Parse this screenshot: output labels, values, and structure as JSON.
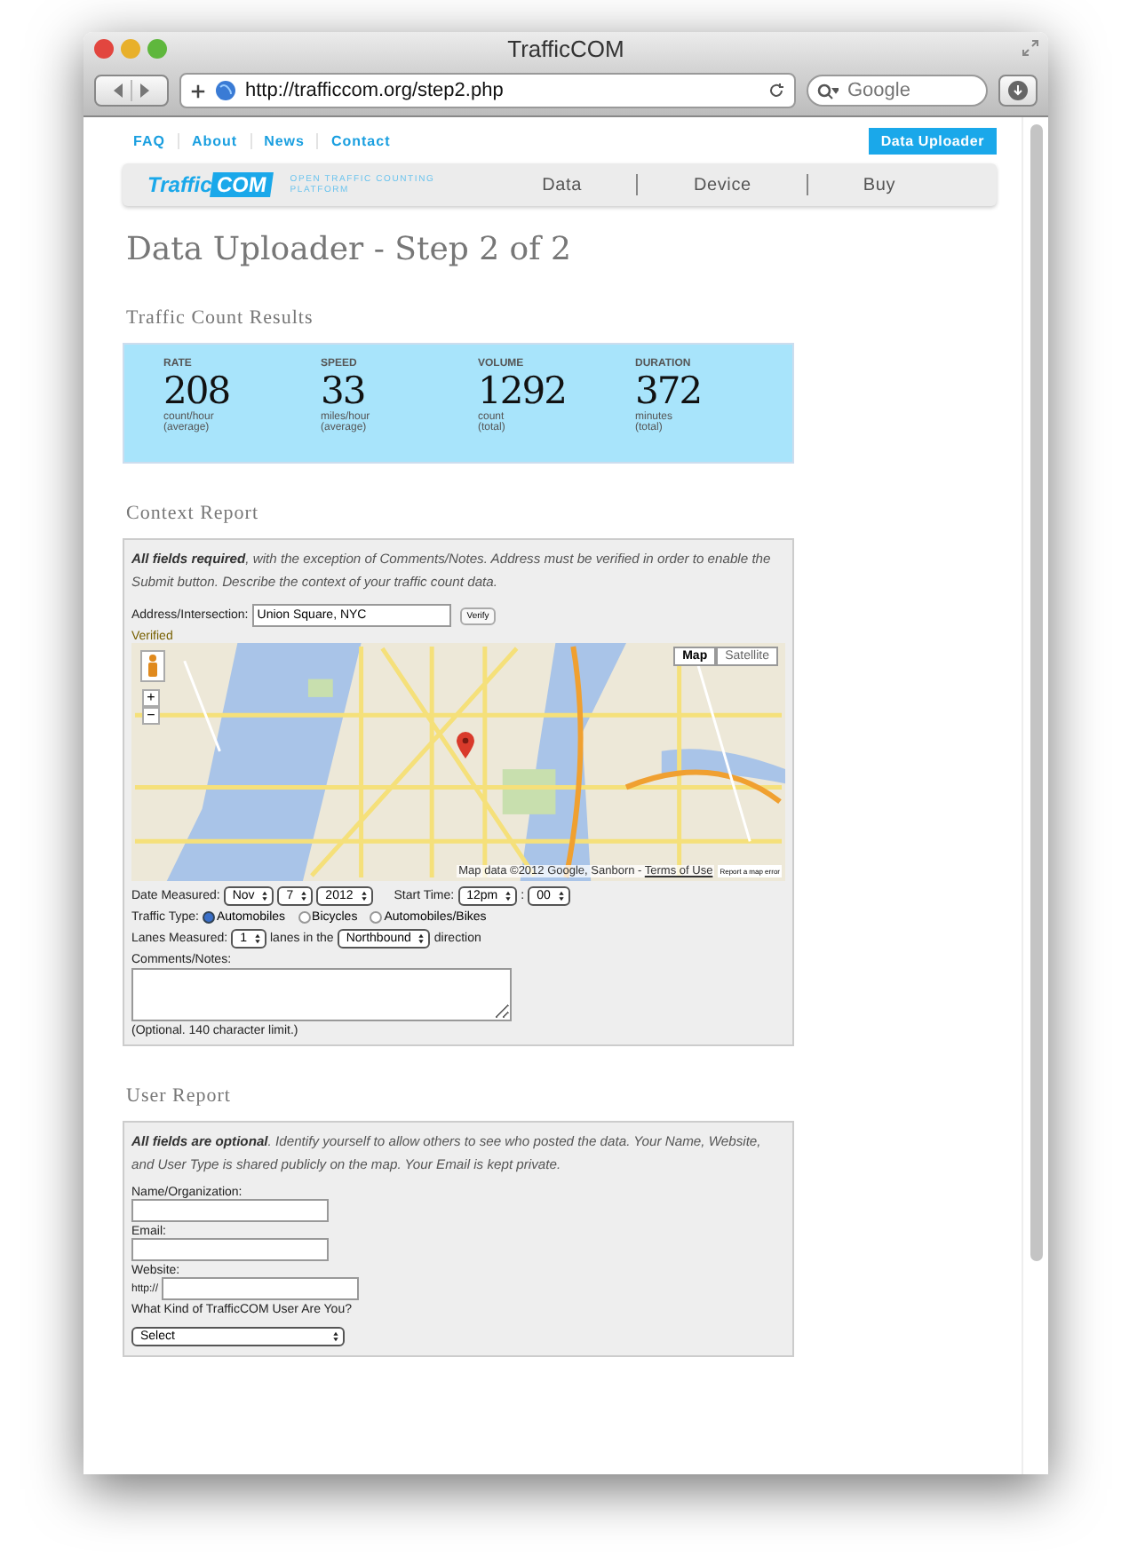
{
  "window": {
    "title": "TrafficCOM"
  },
  "toolbar": {
    "url": "http://trafficcom.org/step2.php",
    "search": {
      "placeholder": "Google"
    }
  },
  "top_links": [
    {
      "label": "FAQ"
    },
    {
      "label": "About"
    },
    {
      "label": "News"
    },
    {
      "label": "Contact"
    }
  ],
  "uploader_button": "Data Uploader",
  "logo": {
    "text": "Traffic",
    "highlight": "COM",
    "tagline": "OPEN TRAFFIC COUNTING PLATFORM"
  },
  "nav": [
    "Data",
    "Device",
    "Buy"
  ],
  "page_title": "Data Uploader - Step 2 of 2",
  "results": {
    "heading": "Traffic Count Results",
    "stats": [
      {
        "label": "RATE",
        "value": "208",
        "unit": "count/hour",
        "note": "(average)"
      },
      {
        "label": "SPEED",
        "value": "33",
        "unit": "miles/hour",
        "note": "(average)"
      },
      {
        "label": "VOLUME",
        "value": "1292",
        "unit": "count",
        "note": "(total)"
      },
      {
        "label": "DURATION",
        "value": "372",
        "unit": "minutes",
        "note": "(total)"
      }
    ]
  },
  "context": {
    "heading": "Context Report",
    "intro": "**All fields required**, with the exception of Comments/Notes. Address must be verified in order to enable the Submit button. Describe the context of your traffic count data.",
    "address": {
      "label": "Address/Intersection:",
      "value": "Union Square, NYC",
      "button": "Verify",
      "status": "Verified"
    },
    "map": {
      "kind": "picture",
      "types": [
        {
          "label": "Map",
          "selected": true
        },
        {
          "label": "Satellite",
          "selected": false
        }
      ],
      "zoom": [
        "+",
        "−"
      ],
      "attribution": "Map data ©2012 Google, Sanborn - ",
      "terms": "Terms of Use",
      "report": "Report a map error"
    },
    "date": {
      "label": "Date Measured:",
      "selects": [
        "Nov",
        "7",
        "2012"
      ]
    },
    "start": {
      "label": "Start Time:",
      "selects": [
        "12pm",
        "00"
      ],
      "separator": ":"
    },
    "traffic_type": {
      "label": "Traffic Type:",
      "options": [
        {
          "label": "Automobiles",
          "selected": true
        },
        {
          "label": "Bicycles",
          "selected": false
        },
        {
          "label": "Automobiles/Bikes",
          "selected": false
        }
      ]
    },
    "lanes": {
      "label": "Lanes Measured:",
      "count": "1",
      "mid": "lanes in the",
      "direction": "Northbound",
      "end": "direction"
    },
    "comments": {
      "label": "Comments/Notes:",
      "hint": "(Optional. 140 character limit.)"
    }
  },
  "user": {
    "heading": "User Report",
    "intro": "**All fields are optional**. Identify yourself to allow others to see who posted the data. Your Name, Website, and User Type is shared publicly on the map. Your Email is kept private.",
    "fields": [
      {
        "label": "Name/Organization:"
      },
      {
        "label": "Email:"
      },
      {
        "label": "Website:",
        "prefix": "http://"
      }
    ],
    "user_type": {
      "label": "What Kind of TrafficCOM User Are You?",
      "value": "Select"
    }
  }
}
